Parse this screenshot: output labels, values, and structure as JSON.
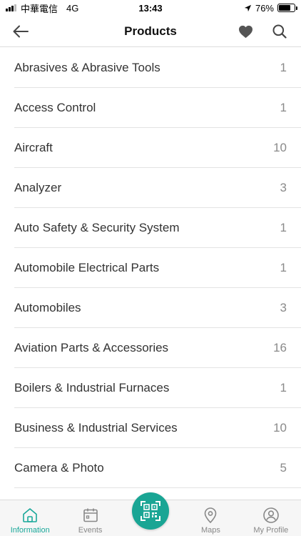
{
  "status_bar": {
    "carrier": "中華電信",
    "network": "4G",
    "time": "13:43",
    "battery": "76%",
    "battery_level": 0.76
  },
  "header": {
    "title": "Products",
    "icons": [
      "back-arrow-icon",
      "heart-icon",
      "search-icon"
    ]
  },
  "products": [
    {
      "label": "Abrasives & Abrasive Tools",
      "count": "1"
    },
    {
      "label": "Access Control",
      "count": "1"
    },
    {
      "label": "Aircraft",
      "count": "10"
    },
    {
      "label": "Analyzer",
      "count": "3"
    },
    {
      "label": "Auto Safety & Security System",
      "count": "1"
    },
    {
      "label": "Automobile Electrical Parts",
      "count": "1"
    },
    {
      "label": "Automobiles",
      "count": "3"
    },
    {
      "label": "Aviation Parts & Accessories",
      "count": "16"
    },
    {
      "label": "Boilers & Industrial Furnaces",
      "count": "1"
    },
    {
      "label": "Business & Industrial Services",
      "count": "10"
    },
    {
      "label": "Camera & Photo",
      "count": "5"
    }
  ],
  "tabbar": {
    "tabs": [
      {
        "label": "Information",
        "icon": "home-icon",
        "active": true
      },
      {
        "label": "Events",
        "icon": "calendar-icon",
        "active": false
      },
      {
        "label": "",
        "icon": "qr-scan-icon",
        "active": false
      },
      {
        "label": "Maps",
        "icon": "map-pin-icon",
        "active": false
      },
      {
        "label": "My Profile",
        "icon": "profile-icon",
        "active": false
      }
    ]
  },
  "colors": {
    "accent": "#19a594",
    "text": "#333333",
    "count": "#8a8a8a",
    "divider": "#e3e3e3"
  }
}
